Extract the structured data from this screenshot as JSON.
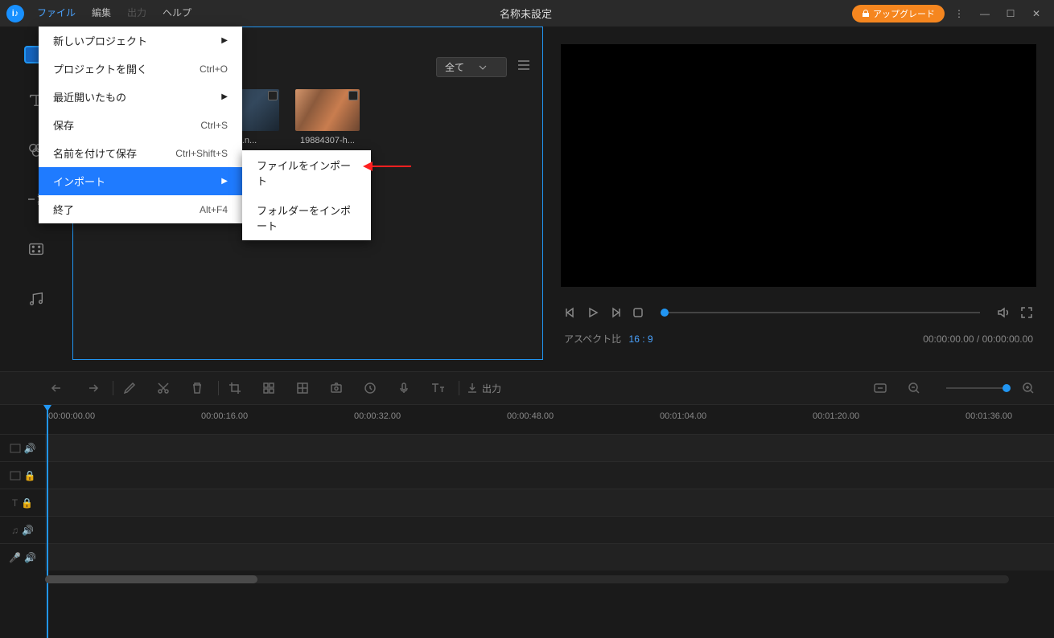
{
  "titlebar": {
    "menus": {
      "file": "ファイル",
      "edit": "編集",
      "output": "出力",
      "help": "ヘルプ"
    },
    "title": "名称未設定",
    "upgrade": "アップグレード"
  },
  "file_menu": {
    "new_project": "新しいプロジェクト",
    "open_project": "プロジェクトを開く",
    "open_shortcut": "Ctrl+O",
    "recent": "最近開いたもの",
    "save": "保存",
    "save_shortcut": "Ctrl+S",
    "save_as": "名前を付けて保存",
    "save_as_shortcut": "Ctrl+Shift+S",
    "import": "インポート",
    "exit": "終了",
    "exit_shortcut": "Alt+F4"
  },
  "import_submenu": {
    "import_file": "ファイルをインポート",
    "import_folder": "フォルダーをインポート"
  },
  "media": {
    "filter": "全て",
    "items": [
      {
        "label": "...n..."
      },
      {
        "label": "19884307-h..."
      }
    ]
  },
  "preview": {
    "aspect_label": "アスペクト比",
    "aspect_value": "16 : 9",
    "time": "00:00:00.00 / 00:00:00.00"
  },
  "toolbar": {
    "export": "出力"
  },
  "timeline": {
    "ticks": [
      "00:00:00.00",
      "00:00:16.00",
      "00:00:32.00",
      "00:00:48.00",
      "00:01:04.00",
      "00:01:20.00",
      "00:01:36.00"
    ]
  }
}
